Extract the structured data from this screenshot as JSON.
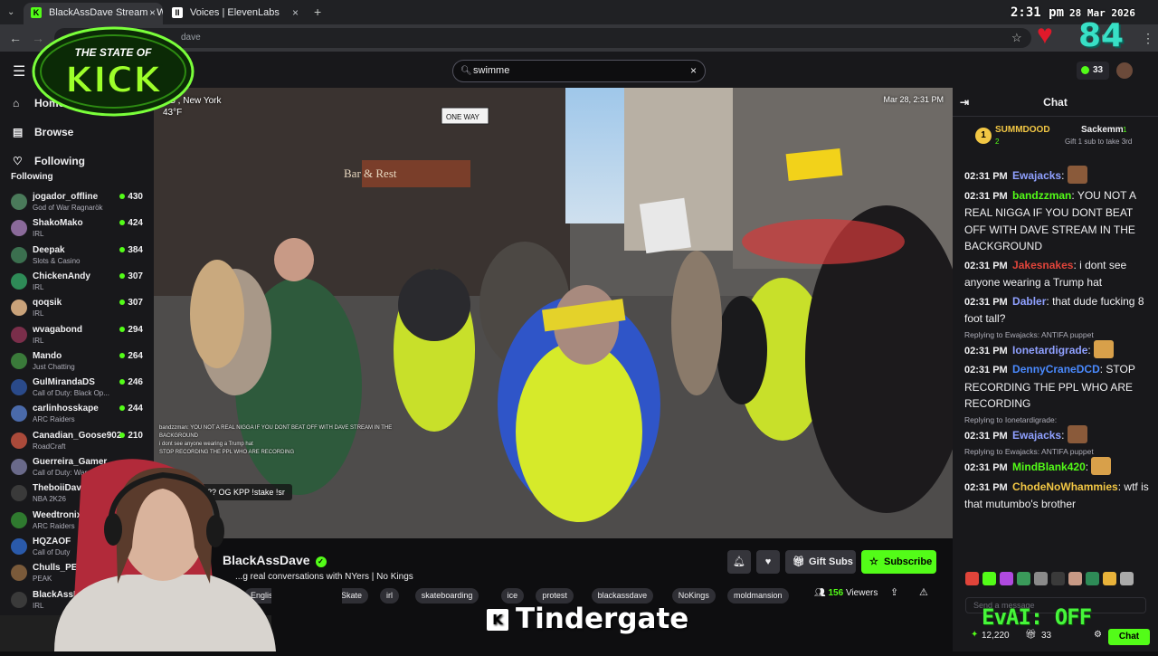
{
  "browser": {
    "tabs": [
      {
        "title": "BlackAssDave Stream - Wat",
        "active": true
      },
      {
        "title": "Voices | ElevenLabs",
        "active": false
      }
    ],
    "new_tab": "+",
    "url_fragment": "dave"
  },
  "overlay": {
    "time": "2:31 pm",
    "date": "28 Mar 2026",
    "counter": "84",
    "logo_text": "THE STATE OF KICK",
    "eva_ai": "EvAI: OFF",
    "caption": "Tindergate",
    "caption_badge": "K"
  },
  "header": {
    "search_value": "swimme",
    "points": "33"
  },
  "sidebar": {
    "nav": [
      {
        "label": "Home",
        "icon": "home-icon"
      },
      {
        "label": "Browse",
        "icon": "browse-icon"
      },
      {
        "label": "Following",
        "icon": "heart-icon"
      }
    ],
    "following_heading": "Following",
    "channels": [
      {
        "name": "jogador_offline",
        "category": "God of War Ragnarök",
        "viewers": "430",
        "color": "#4a7a5a"
      },
      {
        "name": "ShakoMako",
        "category": "IRL",
        "viewers": "424",
        "color": "#8a6a9a"
      },
      {
        "name": "Deepak",
        "category": "Slots & Casino",
        "viewers": "384",
        "color": "#3b6f4f"
      },
      {
        "name": "ChickenAndy",
        "category": "IRL",
        "viewers": "307",
        "color": "#2e8b57"
      },
      {
        "name": "qoqsik",
        "category": "IRL",
        "viewers": "307",
        "color": "#c9a27a"
      },
      {
        "name": "wvagabond",
        "category": "IRL",
        "viewers": "294",
        "color": "#7a2e4a"
      },
      {
        "name": "Mando",
        "category": "Just Chatting",
        "viewers": "264",
        "color": "#3a7a3a"
      },
      {
        "name": "GulMirandaDS",
        "category": "Call of Duty: Black Op...",
        "viewers": "246",
        "color": "#2a4a8a"
      },
      {
        "name": "carlinhosskape",
        "category": "ARC Raiders",
        "viewers": "244",
        "color": "#4a6aaa"
      },
      {
        "name": "Canadian_Goose902",
        "category": "RoadCraft",
        "viewers": "210",
        "color": "#aa4a3a"
      },
      {
        "name": "Guerreira_Gamer",
        "category": "Call of Duty: Warzone",
        "viewers": "",
        "color": "#6a6a8a"
      },
      {
        "name": "TheboiiDavid",
        "category": "NBA 2K26",
        "viewers": "",
        "color": "#3a3a3a"
      },
      {
        "name": "Weedtronix",
        "category": "ARC Raiders",
        "viewers": "",
        "color": "#2f7a2f"
      },
      {
        "name": "HQZAOF",
        "category": "Call of Duty",
        "viewers": "",
        "color": "#2a5aaa"
      },
      {
        "name": "Chulls_PE",
        "category": "PEAK",
        "viewers": "",
        "color": "#7a5a3a"
      },
      {
        "name": "BlackAssDave",
        "category": "IRL",
        "viewers": "",
        "color": "#3a3a3a"
      }
    ]
  },
  "video": {
    "location": "US , New York",
    "temperature": "43°F",
    "timestamp": "Mar 28, 2:31 PM",
    "overlay_chat": [
      "bandzzman: YOU NOT A REAL NIGGA IF YOU DONT BEAT OFF WITH DAVE STREAM IN THE",
      "BACKGROUND",
      "i dont see anyone wearing a Trump hat",
      "STOP RECORDING THE PPL WHO ARE RECORDING"
    ],
    "pinned_overlay": "TW!!?? OG KPP !stake !sr",
    "street_sign": "ONE WAY",
    "store_sign": "Bar & Rest"
  },
  "stream": {
    "name": "BlackAssDave",
    "title": "...g real conversations with NYers | No Kings",
    "tags": [
      "English",
      "nyc",
      "Skate",
      "irl",
      "skateboarding",
      "ice",
      "protest",
      "blackassdave",
      "NoKings",
      "moldmansion"
    ],
    "viewers": "156",
    "viewers_label": "Viewers",
    "gift_label": "Gift Subs",
    "subscribe_label": "Subscribe"
  },
  "chat": {
    "title": "Chat",
    "pinned": {
      "rank": "1",
      "user1": "SUMMDOOD",
      "user1_count": "2",
      "user2": "Sackemm",
      "user2_count": "1",
      "subtitle": "Gift 1 sub to take 3rd"
    },
    "messages": [
      {
        "time": "02:31 PM",
        "user": "Ewajacks",
        "color": "#8fa0ff",
        "text": ""
      },
      {
        "time": "02:31 PM",
        "user": "bandzzman",
        "color": "#53fc18",
        "text": "YOU NOT A REAL NIGGA IF YOU DONT BEAT OFF WITH DAVE STREAM IN THE BACKGROUND"
      },
      {
        "time": "02:31 PM",
        "user": "Jakesnakes",
        "color": "#e0443a",
        "text": "i dont see anyone wearing a Trump hat"
      },
      {
        "time": "02:31 PM",
        "user": "Dabler",
        "color": "#8fa0ff",
        "text": "that dude fucking 8 foot tall?"
      },
      {
        "time": "02:31 PM",
        "user": "Ionetardigrade",
        "color": "#8fa0ff",
        "text": "",
        "reply": "Replying to Ewajacks: ANTIFA puppet"
      },
      {
        "time": "02:31 PM",
        "user": "DennyCraneDCD",
        "color": "#4a8aff",
        "text": "STOP RECORDING THE PPL WHO ARE RECORDING"
      },
      {
        "time": "02:31 PM",
        "user": "Ewajacks",
        "color": "#8fa0ff",
        "text": "",
        "reply": "Replying to Ionetardigrade:"
      },
      {
        "time": "02:31 PM",
        "user": "MindBlank420",
        "color": "#53fc18",
        "text": "",
        "reply": "Replying to Ewajacks: ANTIFA puppet"
      },
      {
        "time": "02:31 PM",
        "user": "ChodeNoWhammies",
        "color": "#f2c744",
        "text": "wtf is that mutumbo's brother"
      }
    ],
    "input_placeholder": "Send a message",
    "footer_points": "12,220",
    "footer_count": "33",
    "chat_button": "Chat"
  }
}
